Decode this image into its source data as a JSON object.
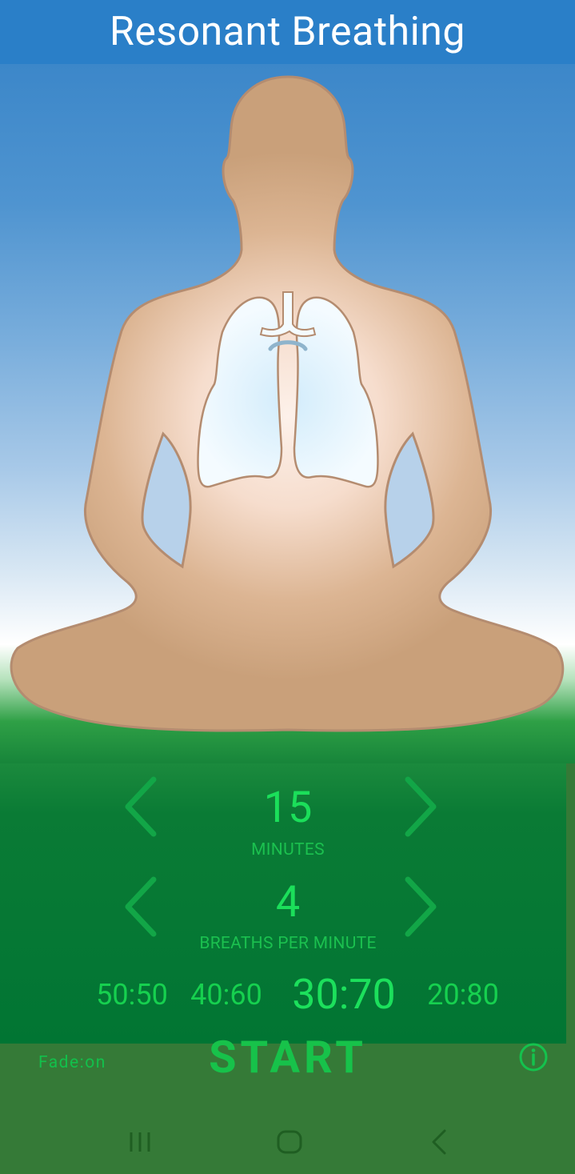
{
  "app": {
    "title": "Resonant Breathing"
  },
  "duration": {
    "value": "15",
    "label": "MINUTES"
  },
  "rate": {
    "value": "4",
    "label": "BREATHS PER MINUTE"
  },
  "ratios": [
    "50:50",
    "40:60",
    "30:70",
    "20:80"
  ],
  "selected_ratio": "30:70",
  "fade": {
    "label": "Fade:on"
  },
  "start": {
    "label": "START"
  },
  "icons": {
    "decrease": "chevron-left-icon",
    "increase": "chevron-right-icon",
    "info": "info-icon",
    "nav_recents": "recents-icon",
    "nav_home": "home-icon",
    "nav_back": "back-icon"
  },
  "colors": {
    "title_bar": "#2a7fc8",
    "accent_green": "#1bdf5a",
    "controls_bg": "#017533",
    "bottom_bg": "#357a37",
    "figure_skin": "#c9a07a"
  }
}
